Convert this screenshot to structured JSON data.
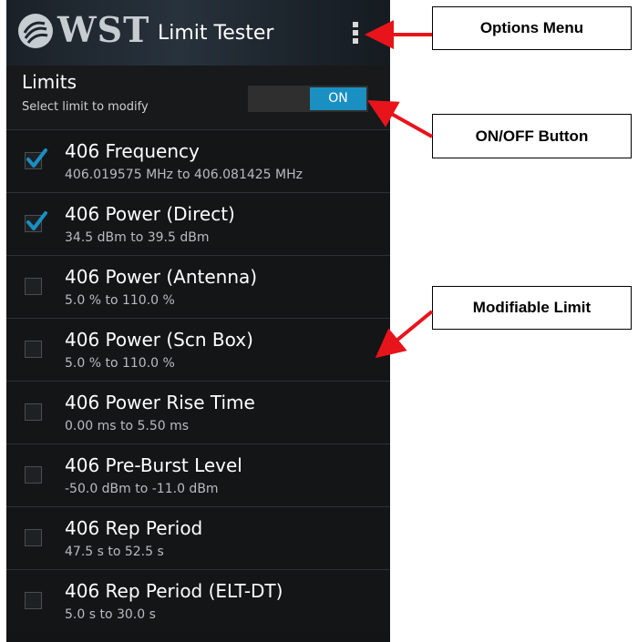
{
  "app": {
    "logo_text": "WST",
    "title": "Limit Tester"
  },
  "limits_header": {
    "title": "Limits",
    "subtitle": "Select limit to modify",
    "toggle_label": "ON"
  },
  "limits": [
    {
      "name": "406 Frequency",
      "range": "406.019575 MHz to 406.081425 MHz",
      "checked": true
    },
    {
      "name": "406 Power (Direct)",
      "range": "34.5 dBm to 39.5 dBm",
      "checked": true
    },
    {
      "name": "406 Power (Antenna)",
      "range": "5.0 % to 110.0 %",
      "checked": false
    },
    {
      "name": "406 Power (Scn Box)",
      "range": "5.0 % to 110.0 %",
      "checked": false
    },
    {
      "name": "406 Power Rise Time",
      "range": "0.00 ms to 5.50 ms",
      "checked": false
    },
    {
      "name": "406 Pre-Burst Level",
      "range": "-50.0 dBm to -11.0 dBm",
      "checked": false
    },
    {
      "name": "406 Rep Period",
      "range": "47.5 s to 52.5 s",
      "checked": false
    },
    {
      "name": "406 Rep Period (ELT-DT)",
      "range": "5.0 s to 30.0 s",
      "checked": false
    }
  ],
  "callouts": {
    "options_menu": "Options Menu",
    "on_off_button": "ON/OFF Button",
    "modifiable_limit": "Modifiable Limit"
  },
  "colors": {
    "accent": "#1a8fc2",
    "arrow": "#e8141b"
  },
  "icons": {
    "logo": "wst-logo-icon",
    "overflow": "overflow-menu-icon",
    "check": "checkmark-icon"
  }
}
